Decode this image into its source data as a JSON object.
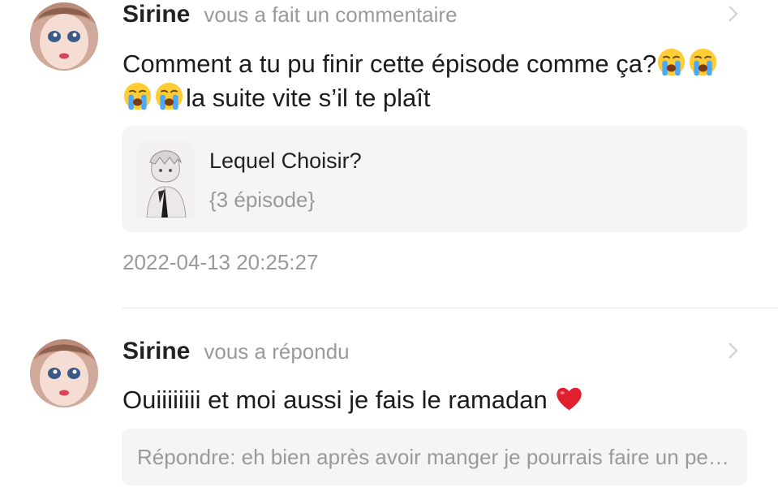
{
  "notifications": [
    {
      "username": "Sirine",
      "action": "vous a fait un commentaire",
      "text_line1": "Comment a tu pu finir cette épisode comme ça?",
      "text_line2": "la suite vite s’il te plaît",
      "emoji_line1": [
        "loudly-crying-face-emoji",
        "loudly-crying-face-emoji"
      ],
      "emoji_line2": [
        "loudly-crying-face-emoji",
        "loudly-crying-face-emoji"
      ],
      "story": {
        "title": "Lequel Choisir?",
        "subtitle": "{3 épisode}"
      },
      "timestamp": "2022-04-13 20:25:27"
    },
    {
      "username": "Sirine",
      "action": "vous a répondu",
      "text": "Ouiiiiiiii et moi aussi je fais le ramadan",
      "emoji": "red-heart-emoji",
      "reply_placeholder": "Répondre: eh bien après avoir manger je pourrais faire un petit chapitre"
    }
  ],
  "icons": {
    "chevron": "chevron-right-icon"
  },
  "colors": {
    "muted": "#9a9a9a",
    "card_bg": "#f5f5f5",
    "divider": "#e4e4e4"
  }
}
